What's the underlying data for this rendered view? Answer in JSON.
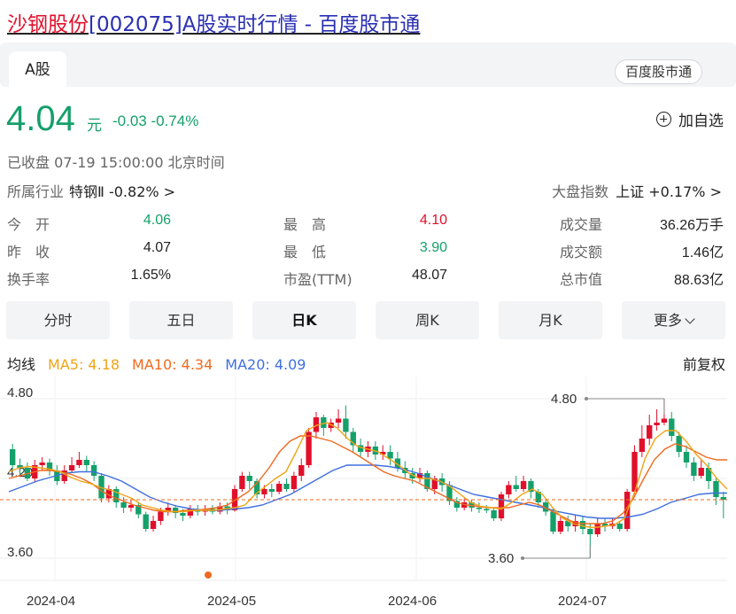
{
  "title": {
    "stock_name": "沙钢股份",
    "rest": "[002075]A股实时行情 - 百度股市通"
  },
  "tabs": {
    "a_share": "A股"
  },
  "brand": "百度股市通",
  "quote": {
    "price": "4.04",
    "unit": "元",
    "change": "-0.03 -0.74%",
    "add_watchlist": "加自选",
    "status": "已收盘  07-19 15:00:00  北京时间",
    "industry_label": "所属行业",
    "industry_value": "特钢Ⅱ -0.82% >",
    "index_label": "大盘指数",
    "index_value": "上证 +0.17% >"
  },
  "stats": {
    "open_label": "今　开",
    "open": "4.06",
    "high_label": "最　高",
    "high": "4.10",
    "volume_label": "成交量",
    "volume": "36.26万手",
    "prev_label": "昨　收",
    "prev": "4.07",
    "low_label": "最　低",
    "low": "3.90",
    "amount_label": "成交额",
    "amount": "1.46亿",
    "turnover_label": "换手率",
    "turnover": "1.65%",
    "pe_label": "市盈(TTM)",
    "pe": "48.07",
    "mcap_label": "总市值",
    "mcap": "88.63亿"
  },
  "kline_tabs": [
    "分时",
    "五日",
    "日K",
    "周K",
    "月K",
    "更多"
  ],
  "active_tab": "日K",
  "ma": {
    "label": "均线",
    "ma5": "MA5: 4.18",
    "ma10": "MA10: 4.34",
    "ma20": "MA20: 4.09",
    "adjust": "前复权"
  },
  "colors": {
    "up": "#e0102b",
    "down": "#14a06a",
    "ma5": "#f0a417",
    "ma10": "#ef6a1f",
    "ma20": "#3f6fe0",
    "last_price_line": "#ef6a1f"
  },
  "chart_data": {
    "type": "candlestick",
    "y_ticks": [
      "4.80",
      "4.20",
      "3.60"
    ],
    "x_ticks": [
      "2024-04",
      "2024-05",
      "2024-06",
      "2024-07"
    ],
    "ylim": [
      3.5,
      4.9
    ],
    "max_label": "4.80",
    "min_label": "3.60",
    "last_price": 4.04,
    "candles": [
      [
        4.42,
        4.3,
        4.46,
        4.26
      ],
      [
        4.3,
        4.28,
        4.35,
        4.22
      ],
      [
        4.28,
        4.2,
        4.32,
        4.18
      ],
      [
        4.2,
        4.3,
        4.34,
        4.17
      ],
      [
        4.3,
        4.32,
        4.36,
        4.26
      ],
      [
        4.32,
        4.26,
        4.35,
        4.22
      ],
      [
        4.26,
        4.18,
        4.3,
        4.15
      ],
      [
        4.18,
        4.26,
        4.3,
        4.16
      ],
      [
        4.26,
        4.3,
        4.36,
        4.24
      ],
      [
        4.3,
        4.34,
        4.4,
        4.28
      ],
      [
        4.34,
        4.3,
        4.37,
        4.25
      ],
      [
        4.3,
        4.22,
        4.33,
        4.18
      ],
      [
        4.22,
        4.05,
        4.24,
        4.02
      ],
      [
        4.05,
        4.12,
        4.15,
        4.02
      ],
      [
        4.12,
        4.02,
        4.14,
        3.98
      ],
      [
        4.02,
        3.98,
        4.06,
        3.94
      ],
      [
        3.98,
        4.0,
        4.04,
        3.95
      ],
      [
        4.0,
        3.93,
        4.02,
        3.9
      ],
      [
        3.93,
        3.82,
        3.95,
        3.8
      ],
      [
        3.82,
        3.88,
        3.92,
        3.8
      ],
      [
        3.88,
        3.95,
        3.98,
        3.85
      ],
      [
        3.95,
        3.98,
        4.02,
        3.92
      ],
      [
        3.98,
        3.94,
        4.0,
        3.9
      ],
      [
        3.94,
        3.92,
        3.97,
        3.88
      ],
      [
        3.92,
        3.97,
        4.0,
        3.9
      ],
      [
        3.97,
        3.95,
        4.0,
        3.92
      ],
      [
        3.95,
        3.97,
        4.0,
        3.92
      ],
      [
        3.97,
        3.95,
        4.0,
        3.93
      ],
      [
        3.95,
        3.99,
        4.02,
        3.93
      ],
      [
        3.99,
        3.96,
        4.02,
        3.93
      ],
      [
        3.96,
        4.12,
        4.15,
        3.95
      ],
      [
        4.12,
        4.22,
        4.25,
        4.1
      ],
      [
        4.22,
        4.18,
        4.25,
        4.12
      ],
      [
        4.18,
        4.08,
        4.2,
        4.05
      ],
      [
        4.08,
        4.12,
        4.15,
        4.05
      ],
      [
        4.12,
        4.1,
        4.16,
        4.06
      ],
      [
        4.1,
        4.16,
        4.18,
        4.08
      ],
      [
        4.16,
        4.12,
        4.2,
        4.1
      ],
      [
        4.12,
        4.22,
        4.25,
        4.1
      ],
      [
        4.22,
        4.3,
        4.35,
        4.18
      ],
      [
        4.3,
        4.55,
        4.58,
        4.28
      ],
      [
        4.55,
        4.66,
        4.7,
        4.5
      ],
      [
        4.66,
        4.58,
        4.68,
        4.52
      ],
      [
        4.58,
        4.62,
        4.65,
        4.55
      ],
      [
        4.62,
        4.65,
        4.72,
        4.58
      ],
      [
        4.65,
        4.55,
        4.75,
        4.5
      ],
      [
        4.55,
        4.45,
        4.58,
        4.4
      ],
      [
        4.45,
        4.4,
        4.5,
        4.36
      ],
      [
        4.4,
        4.44,
        4.48,
        4.36
      ],
      [
        4.44,
        4.38,
        4.48,
        4.34
      ],
      [
        4.38,
        4.4,
        4.45,
        4.34
      ],
      [
        4.4,
        4.35,
        4.45,
        4.3
      ],
      [
        4.35,
        4.28,
        4.4,
        4.25
      ],
      [
        4.28,
        4.24,
        4.33,
        4.2
      ],
      [
        4.24,
        4.2,
        4.28,
        4.16
      ],
      [
        4.2,
        4.24,
        4.28,
        4.17
      ],
      [
        4.24,
        4.12,
        4.26,
        4.1
      ],
      [
        4.12,
        4.2,
        4.22,
        4.08
      ],
      [
        4.2,
        4.15,
        4.24,
        4.1
      ],
      [
        4.15,
        4.03,
        4.18,
        4.0
      ],
      [
        4.03,
        3.98,
        4.06,
        3.95
      ],
      [
        3.98,
        4.02,
        4.05,
        3.96
      ],
      [
        4.02,
        3.98,
        4.04,
        3.95
      ],
      [
        3.98,
        3.97,
        4.02,
        3.94
      ],
      [
        3.97,
        3.96,
        4.0,
        3.94
      ],
      [
        3.96,
        3.9,
        3.98,
        3.88
      ],
      [
        3.9,
        4.08,
        4.1,
        3.88
      ],
      [
        4.08,
        4.15,
        4.18,
        4.05
      ],
      [
        4.15,
        4.12,
        4.22,
        4.1
      ],
      [
        4.12,
        4.18,
        4.22,
        4.1
      ],
      [
        4.18,
        4.1,
        4.2,
        4.05
      ],
      [
        4.1,
        4.02,
        4.12,
        3.98
      ],
      [
        4.02,
        3.95,
        4.05,
        3.92
      ],
      [
        3.95,
        3.8,
        3.98,
        3.78
      ],
      [
        3.8,
        3.88,
        3.92,
        3.78
      ],
      [
        3.88,
        3.84,
        3.92,
        3.8
      ],
      [
        3.84,
        3.88,
        3.92,
        3.8
      ],
      [
        3.88,
        3.82,
        3.92,
        3.78
      ],
      [
        3.82,
        3.78,
        3.86,
        3.6
      ],
      [
        3.78,
        3.86,
        3.9,
        3.76
      ],
      [
        3.86,
        3.84,
        3.9,
        3.8
      ],
      [
        3.84,
        3.86,
        3.9,
        3.82
      ],
      [
        3.86,
        3.82,
        3.88,
        3.8
      ],
      [
        3.82,
        4.1,
        4.12,
        3.8
      ],
      [
        4.1,
        4.4,
        4.45,
        4.08
      ],
      [
        4.4,
        4.5,
        4.6,
        4.36
      ],
      [
        4.5,
        4.6,
        4.68,
        4.45
      ],
      [
        4.6,
        4.62,
        4.72,
        4.56
      ],
      [
        4.62,
        4.65,
        4.8,
        4.6
      ],
      [
        4.65,
        4.52,
        4.7,
        4.48
      ],
      [
        4.52,
        4.4,
        4.55,
        4.36
      ],
      [
        4.4,
        4.32,
        4.45,
        4.28
      ],
      [
        4.32,
        4.22,
        4.36,
        4.18
      ],
      [
        4.22,
        4.28,
        4.35,
        4.2
      ],
      [
        4.28,
        4.18,
        4.32,
        4.12
      ],
      [
        4.18,
        4.06,
        4.2,
        4.0
      ],
      [
        4.06,
        4.04,
        4.1,
        3.9
      ]
    ],
    "ma5": [
      4.25,
      4.28,
      4.29,
      4.28,
      4.27,
      4.25,
      4.21,
      4.18,
      4.16,
      4.13,
      4.11,
      4.08,
      4.05,
      4.0,
      3.98,
      3.96,
      3.95,
      3.95,
      3.96,
      3.96,
      3.96,
      3.97,
      3.98,
      4.0,
      4.08,
      4.14,
      4.2,
      4.25,
      4.4,
      4.56,
      4.6,
      4.62,
      4.58,
      4.5,
      4.44,
      4.42,
      4.4,
      4.35,
      4.3,
      4.24,
      4.2,
      4.2,
      4.18,
      4.14,
      4.08,
      4.02,
      3.99,
      3.98,
      3.97,
      4.02,
      4.08,
      4.12,
      4.08,
      3.98,
      3.9,
      3.86,
      3.84,
      3.83,
      3.84,
      3.85,
      3.9,
      4.1,
      4.35,
      4.5,
      4.56,
      4.56,
      4.48,
      4.38,
      4.3,
      4.2,
      4.12
    ],
    "ma10": [
      4.2,
      4.22,
      4.24,
      4.26,
      4.26,
      4.25,
      4.23,
      4.2,
      4.16,
      4.1,
      4.06,
      4.03,
      4.0,
      3.98,
      3.96,
      3.95,
      3.95,
      3.96,
      3.96,
      3.97,
      3.98,
      4.0,
      4.05,
      4.1,
      4.18,
      4.28,
      4.4,
      4.48,
      4.52,
      4.52,
      4.5,
      4.48,
      4.44,
      4.4,
      4.35,
      4.3,
      4.25,
      4.22,
      4.2,
      4.18,
      4.14,
      4.1,
      4.06,
      4.02,
      4.0,
      3.99,
      3.98,
      3.98,
      3.98,
      4.0,
      4.02,
      4.0,
      3.96,
      3.92,
      3.88,
      3.86,
      3.86,
      3.86,
      3.88,
      3.94,
      4.05,
      4.2,
      4.34,
      4.42,
      4.46,
      4.44,
      4.4,
      4.36,
      4.34,
      4.34
    ],
    "ma20": [
      4.1,
      4.14,
      4.18,
      4.21,
      4.24,
      4.25,
      4.25,
      4.22,
      4.18,
      4.12,
      4.06,
      4.02,
      3.99,
      3.97,
      3.96,
      3.96,
      3.97,
      3.98,
      4.0,
      4.04,
      4.08,
      4.14,
      4.2,
      4.26,
      4.3,
      4.3,
      4.3,
      4.29,
      4.27,
      4.24,
      4.2,
      4.16,
      4.12,
      4.08,
      4.06,
      4.04,
      4.02,
      4.0,
      3.98,
      3.95,
      3.93,
      3.91,
      3.9,
      3.9,
      3.91,
      3.93,
      3.97,
      4.02,
      4.05,
      4.08,
      4.09,
      4.09
    ]
  }
}
